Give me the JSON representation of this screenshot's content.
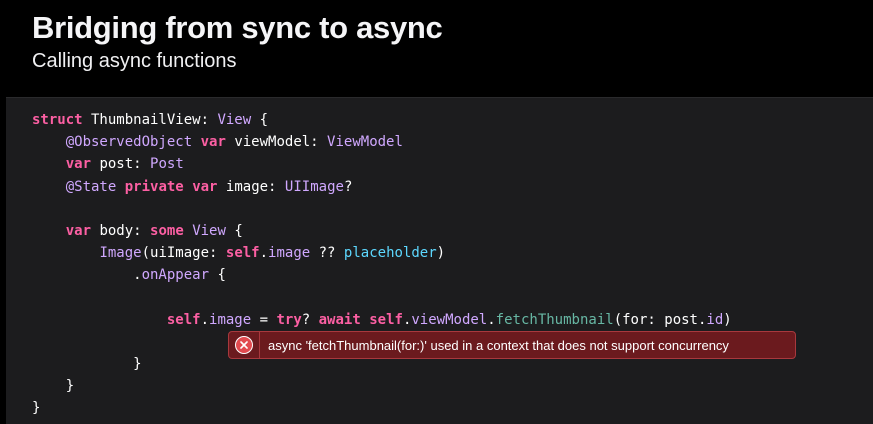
{
  "slide": {
    "title": "Bridging from sync to async",
    "subtitle": "Calling async functions"
  },
  "code": {
    "lines": [
      [
        {
          "t": "struct",
          "c": "kw"
        },
        {
          "t": " ThumbnailView: ",
          "c": "nm"
        },
        {
          "t": "View",
          "c": "ty"
        },
        {
          "t": " {",
          "c": "nm"
        }
      ],
      [
        {
          "t": "    ",
          "c": "nm"
        },
        {
          "t": "@ObservedObject",
          "c": "ty"
        },
        {
          "t": " ",
          "c": "nm"
        },
        {
          "t": "var",
          "c": "kw"
        },
        {
          "t": " viewModel: ",
          "c": "nm"
        },
        {
          "t": "ViewModel",
          "c": "ty"
        }
      ],
      [
        {
          "t": "    ",
          "c": "nm"
        },
        {
          "t": "var",
          "c": "kw"
        },
        {
          "t": " post: ",
          "c": "nm"
        },
        {
          "t": "Post",
          "c": "ty"
        }
      ],
      [
        {
          "t": "    ",
          "c": "nm"
        },
        {
          "t": "@State",
          "c": "ty"
        },
        {
          "t": " ",
          "c": "nm"
        },
        {
          "t": "private",
          "c": "kw"
        },
        {
          "t": " ",
          "c": "nm"
        },
        {
          "t": "var",
          "c": "kw"
        },
        {
          "t": " image: ",
          "c": "nm"
        },
        {
          "t": "UIImage",
          "c": "ty"
        },
        {
          "t": "?",
          "c": "nm"
        }
      ],
      [],
      [
        {
          "t": "    ",
          "c": "nm"
        },
        {
          "t": "var",
          "c": "kw"
        },
        {
          "t": " body: ",
          "c": "nm"
        },
        {
          "t": "some",
          "c": "kw"
        },
        {
          "t": " ",
          "c": "nm"
        },
        {
          "t": "View",
          "c": "ty"
        },
        {
          "t": " {",
          "c": "nm"
        }
      ],
      [
        {
          "t": "        ",
          "c": "nm"
        },
        {
          "t": "Image",
          "c": "ty"
        },
        {
          "t": "(uiImage: ",
          "c": "nm"
        },
        {
          "t": "self",
          "c": "kw"
        },
        {
          "t": ".",
          "c": "nm"
        },
        {
          "t": "image",
          "c": "ty"
        },
        {
          "t": " ?? ",
          "c": "nm"
        },
        {
          "t": "placeholder",
          "c": "ph"
        },
        {
          "t": ")",
          "c": "nm"
        }
      ],
      [
        {
          "t": "            .",
          "c": "nm"
        },
        {
          "t": "onAppear",
          "c": "ty"
        },
        {
          "t": " {",
          "c": "nm"
        }
      ],
      [],
      [
        {
          "t": "                ",
          "c": "nm"
        },
        {
          "t": "self",
          "c": "kw"
        },
        {
          "t": ".",
          "c": "nm"
        },
        {
          "t": "image",
          "c": "ty"
        },
        {
          "t": " = ",
          "c": "nm"
        },
        {
          "t": "try",
          "c": "kw"
        },
        {
          "t": "? ",
          "c": "nm"
        },
        {
          "t": "await",
          "c": "kw"
        },
        {
          "t": " ",
          "c": "nm"
        },
        {
          "t": "self",
          "c": "kw"
        },
        {
          "t": ".",
          "c": "nm"
        },
        {
          "t": "viewModel",
          "c": "ty"
        },
        {
          "t": ".",
          "c": "nm"
        },
        {
          "t": "fetchThumbnail",
          "c": "fn"
        },
        {
          "t": "(for: post.",
          "c": "nm"
        },
        {
          "t": "id",
          "c": "ty"
        },
        {
          "t": ")",
          "c": "nm"
        }
      ],
      [],
      [
        {
          "t": "            }",
          "c": "nm"
        }
      ],
      [
        {
          "t": "    }",
          "c": "nm"
        }
      ],
      [
        {
          "t": "}",
          "c": "nm"
        }
      ]
    ]
  },
  "error": {
    "message": "async 'fetchThumbnail(for:)' used in a context that does not support concurrency",
    "icon": "error-x-circle-icon",
    "background": "#6b1a1e",
    "accent": "#e24a4f"
  }
}
